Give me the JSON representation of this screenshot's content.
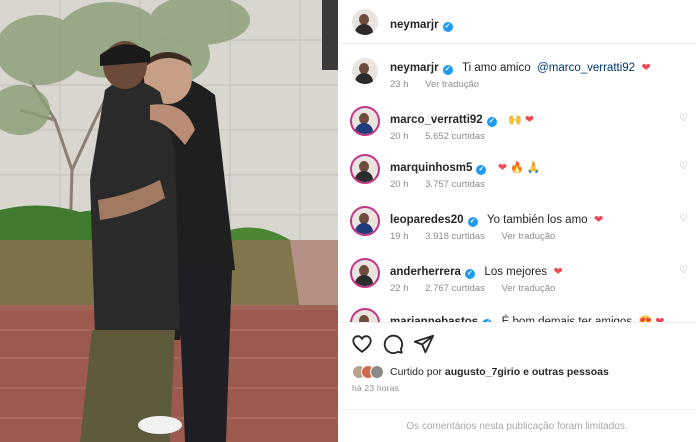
{
  "post": {
    "author": "neymarjr",
    "caption": {
      "username": "neymarjr",
      "text": "Ti amo amico",
      "mention": "@marco_verratti92",
      "emoji": "❤",
      "time": "23 h",
      "translate": "Ver tradução"
    }
  },
  "comments": [
    {
      "username": "marco_verratti92",
      "text": "",
      "emoji": "🙌 ❤",
      "time": "20 h",
      "likes": "5.652 curtidas",
      "translate": ""
    },
    {
      "username": "marquinhosm5",
      "text": "",
      "emoji": "❤ 🔥 🙏",
      "time": "20 h",
      "likes": "3.757 curtidas",
      "translate": ""
    },
    {
      "username": "leoparedes20",
      "text": "Yo también los amo",
      "emoji": "❤",
      "time": "19 h",
      "likes": "3.918 curtidas",
      "translate": "Ver tradução"
    },
    {
      "username": "anderherrera",
      "text": "Los mejores",
      "emoji": "❤",
      "time": "22 h",
      "likes": "2.767 curtidas",
      "translate": "Ver tradução"
    },
    {
      "username": "mariannebastos",
      "text": "É bom demais ter amigos",
      "emoji": "😍 ❤",
      "time": "",
      "likes": "",
      "translate": ""
    }
  ],
  "footer": {
    "liked_by_prefix": "Curtido por",
    "liked_by_user": "augusto_7girio",
    "liked_by_suffix": "e outras pessoas",
    "time_ago": "há 23 horas",
    "comments_limited": "Os comentários nesta publicação foram limitados."
  },
  "colors": {
    "verified": "#1d9bf0",
    "heart": "#ed4956",
    "story_ring": "#c13584",
    "muted": "#8e8e8e"
  },
  "icons": [
    "heart-icon",
    "comment-icon",
    "share-icon",
    "verified-icon"
  ]
}
